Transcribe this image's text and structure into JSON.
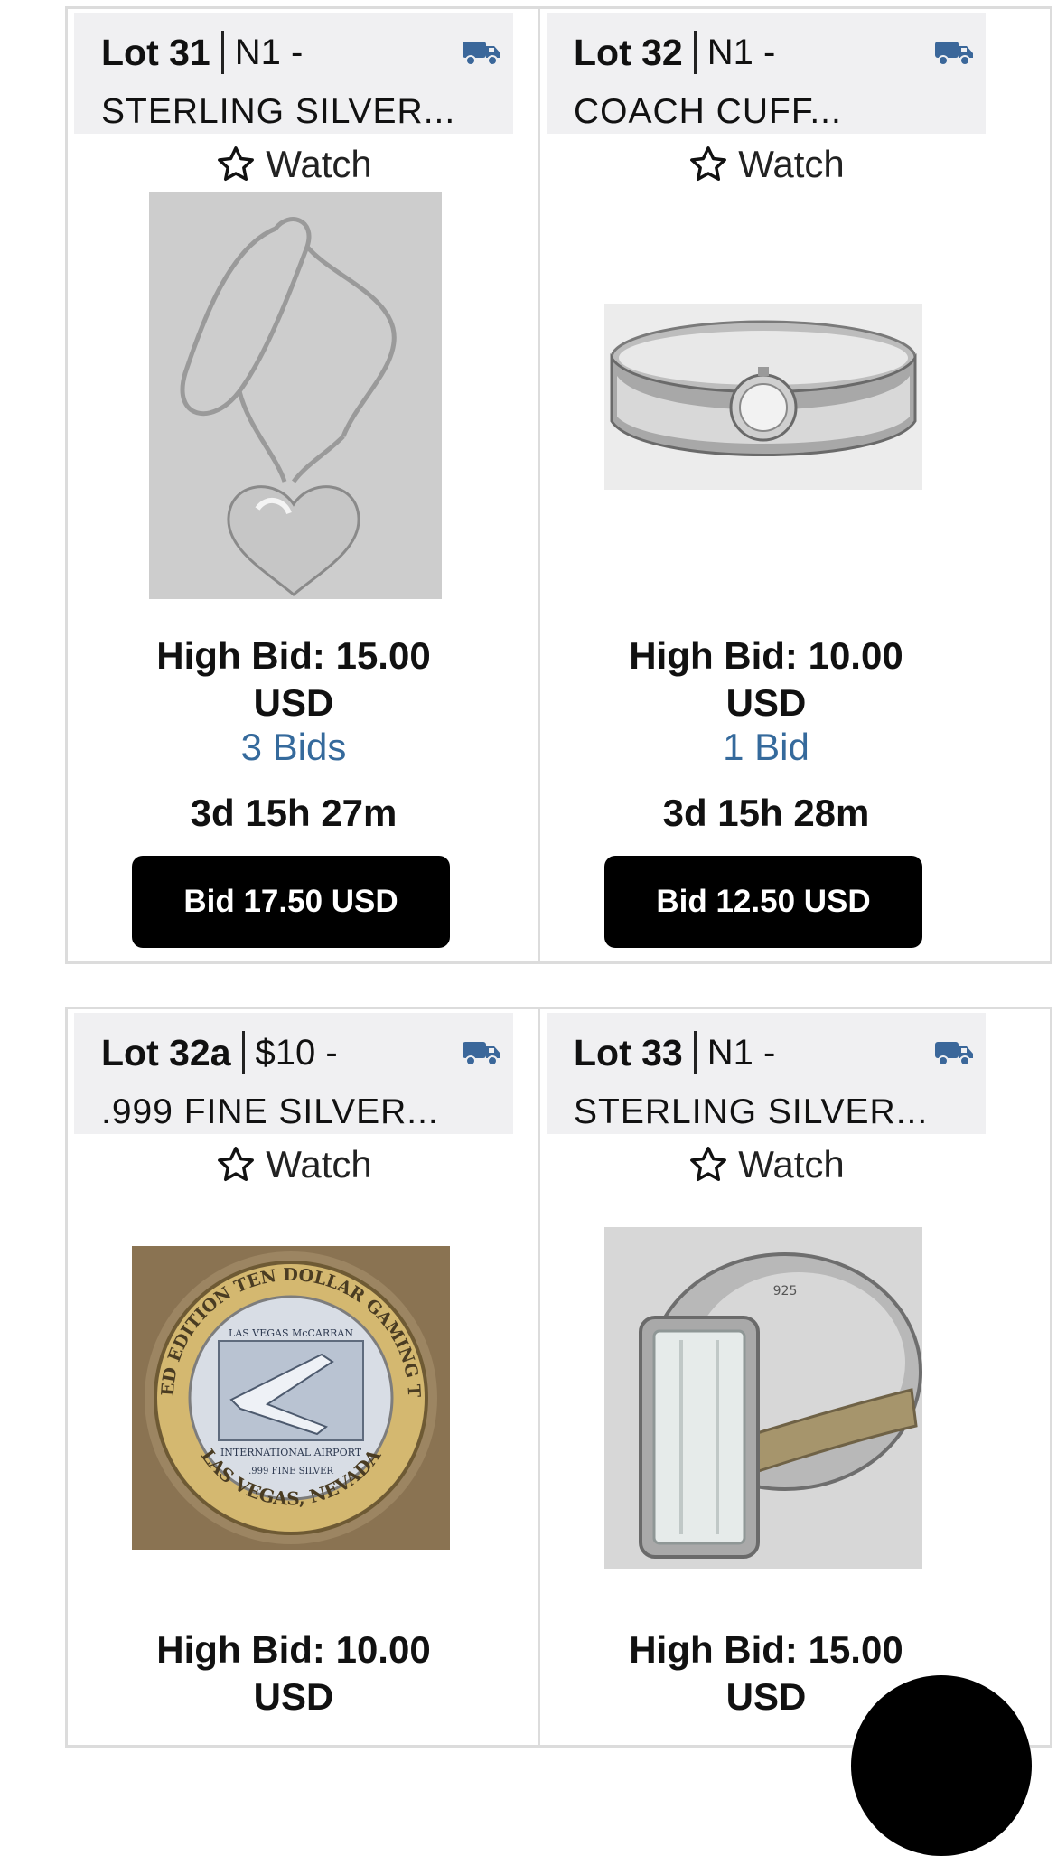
{
  "colors": {
    "accent_link": "#356a9c",
    "truck_icon": "#3b679a",
    "button_bg": "#000000",
    "card_header_bg": "#f0f0f2"
  },
  "icons": {
    "shipping": "truck-icon",
    "watch": "star-outline-icon"
  },
  "lots": [
    {
      "lot": "Lot 31",
      "code": "N1 -",
      "title": "STERLING SILVER...",
      "watch": "Watch",
      "high_bid": "High Bid: 15.00",
      "currency": "USD",
      "bids": "3 Bids",
      "time_left": "3d 15h 27m",
      "bid_button": "Bid 17.50 USD"
    },
    {
      "lot": "Lot 32",
      "code": "N1 -",
      "title": "COACH CUFF...",
      "watch": "Watch",
      "high_bid": "High Bid: 10.00",
      "currency": "USD",
      "bids": "1 Bid",
      "time_left": "3d 15h 28m",
      "bid_button": "Bid 12.50 USD"
    },
    {
      "lot": "Lot 32a",
      "code": "$10 -",
      "title": ".999 FINE SILVER...",
      "watch": "Watch",
      "high_bid": "High Bid: 10.00",
      "currency": "USD",
      "coin_text": {
        "top": "LIMITED EDITION TEN DOLLAR GAMING TOKEN",
        "bottom": "LAS VEGAS, NEVADA",
        "line1": "LAS VEGAS McCARRAN",
        "line2": "INTERNATIONAL AIRPORT",
        "line3": ".999 FINE SILVER"
      }
    },
    {
      "lot": "Lot 33",
      "code": "N1 -",
      "title": "STERLING SILVER...",
      "watch": "Watch",
      "high_bid": "High Bid: 15.00",
      "currency": "USD",
      "ring_stamp": "925"
    }
  ]
}
